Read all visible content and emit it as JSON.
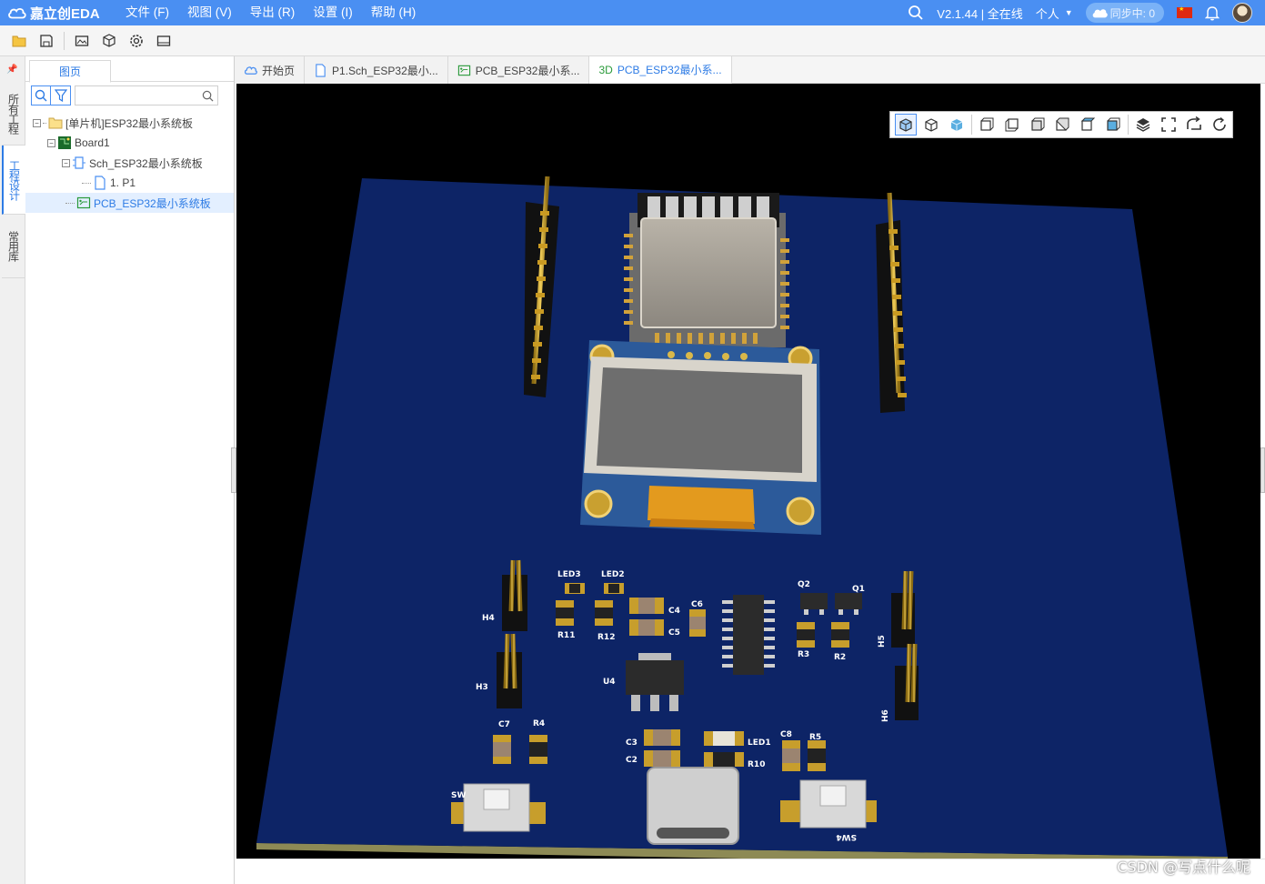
{
  "app": {
    "logo_text": "嘉立创EDA",
    "version": "V2.1.44 | 全在线",
    "personal": "个人",
    "sync": "同步中: 0"
  },
  "menu": [
    "文件 (F)",
    "视图 (V)",
    "导出 (R)",
    "设置 (I)",
    "帮助 (H)"
  ],
  "side_tabs": [
    "所有工程",
    "工程设计",
    "常用库"
  ],
  "panel": {
    "tab": "图页",
    "search_placeholder": ""
  },
  "tree": [
    {
      "label": "[单片机]ESP32最小系统板",
      "icon": "folder-icon",
      "level": 0
    },
    {
      "label": "Board1",
      "icon": "board-icon",
      "level": 1
    },
    {
      "label": "Sch_ESP32最小系统板",
      "icon": "schematic-icon",
      "level": 2
    },
    {
      "label": "1. P1",
      "icon": "page-icon",
      "level": 3
    },
    {
      "label": "PCB_ESP32最小系统板",
      "icon": "pcb-icon",
      "level": 2,
      "selected": true
    }
  ],
  "doc_tabs": [
    {
      "label": "开始页",
      "icon": "cloud-icon"
    },
    {
      "label": "P1.Sch_ESP32最小...",
      "icon": "page-icon"
    },
    {
      "label": "PCB_ESP32最小系...",
      "icon": "pcb-icon"
    },
    {
      "label": "PCB_ESP32最小系...",
      "icon": "3d-icon",
      "prefix": "3D",
      "active": true
    }
  ],
  "silkscreen": {
    "LED3": "LED3",
    "LED2": "LED2",
    "C4": "C4",
    "C5": "C5",
    "C6": "C6",
    "Q2": "Q2",
    "Q1": "Q1",
    "R3": "R3",
    "R2": "R2",
    "R11": "R11",
    "R12": "R12",
    "H4": "H4",
    "H3": "H3",
    "H5": "H5",
    "H6": "H6",
    "U4": "U4",
    "C7": "C7",
    "R4": "R4",
    "C3": "C3",
    "C2": "C2",
    "LED1": "LED1",
    "R10": "R10",
    "C8": "C8",
    "R5": "R5",
    "SW": "SW",
    "SW4": "SW4"
  },
  "watermark": "CSDN @写点什么呢",
  "colors": {
    "menubar": "#4a8ff2",
    "accent": "#2d7be5",
    "board": "#0d2466",
    "viewport_bg": "#000000",
    "gold": "#d4a82a"
  }
}
